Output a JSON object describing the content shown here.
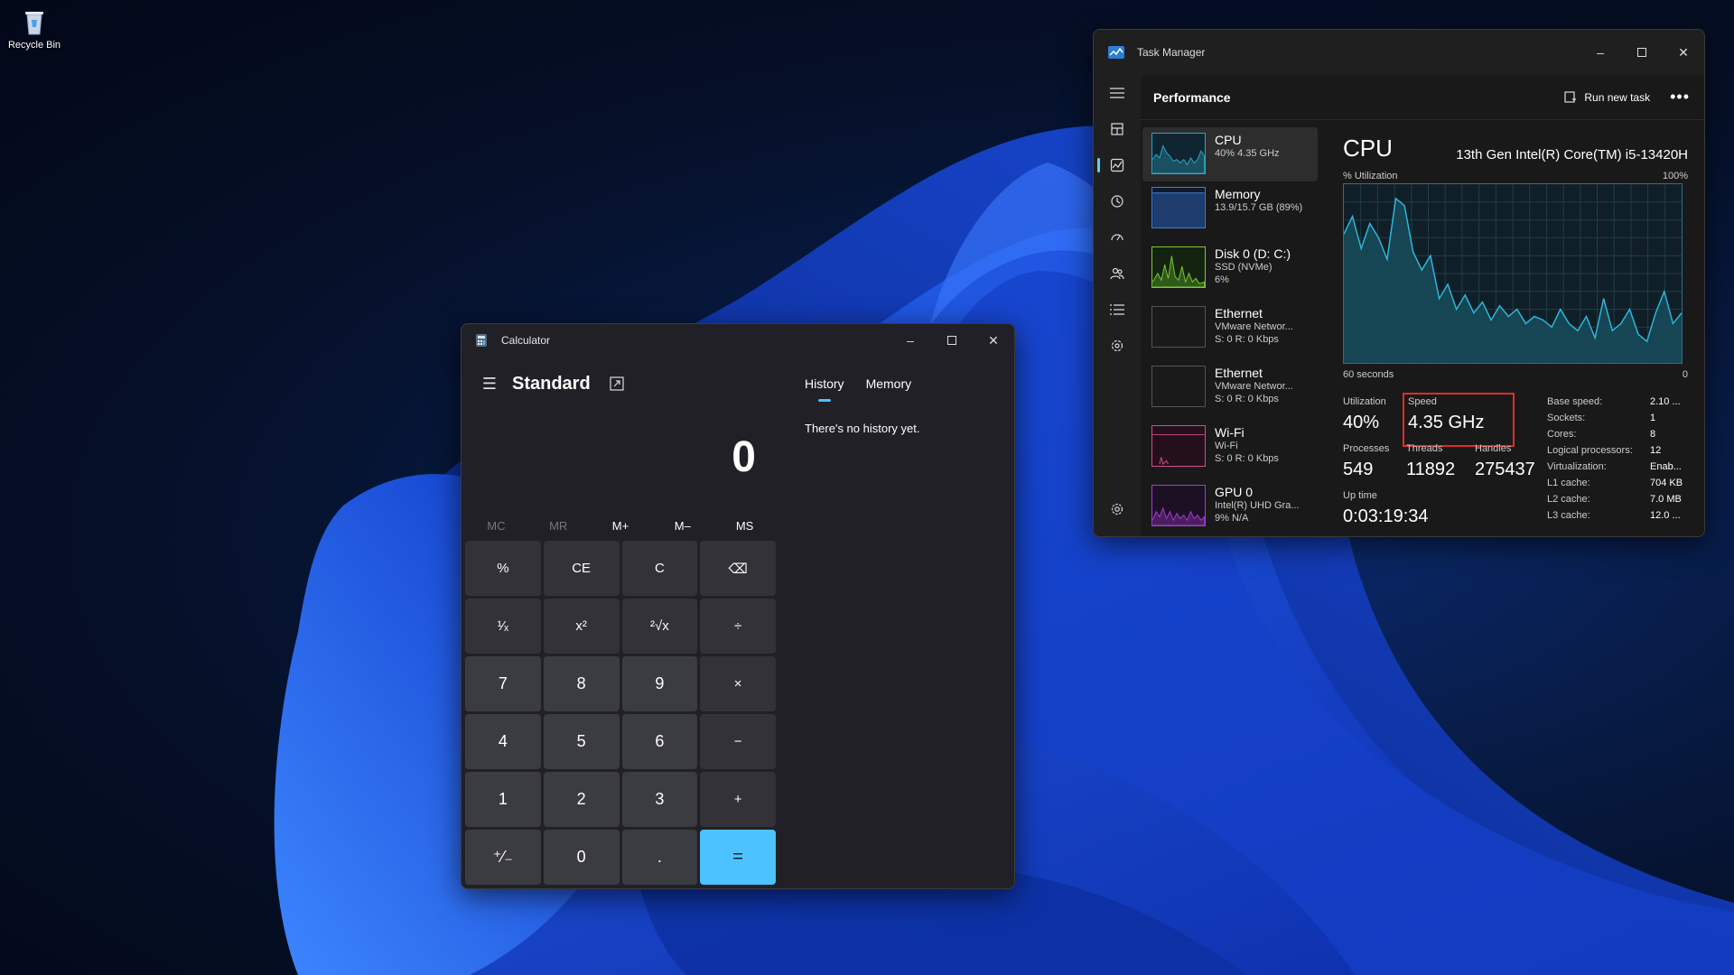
{
  "desktop": {
    "recycle_bin_label": "Recycle Bin"
  },
  "calculator": {
    "title": "Calculator",
    "mode": "Standard",
    "display": "0",
    "tabs": {
      "history": "History",
      "memory": "Memory"
    },
    "history_empty": "There's no history yet.",
    "memory_buttons": [
      "MC",
      "MR",
      "M+",
      "M–",
      "MS"
    ],
    "keys": {
      "percent": "%",
      "ce": "CE",
      "c": "C",
      "backspace": "⌫",
      "reciprocal": "¹⁄ₓ",
      "square": "x²",
      "sqrt": "²√x",
      "divide": "÷",
      "seven": "7",
      "eight": "8",
      "nine": "9",
      "multiply": "×",
      "four": "4",
      "five": "5",
      "six": "6",
      "minus": "−",
      "one": "1",
      "two": "2",
      "three": "3",
      "plus": "+",
      "negate": "⁺⁄₋",
      "zero": "0",
      "decimal": ".",
      "equals": "="
    },
    "accent": "#4cc2ff"
  },
  "task_manager": {
    "title": "Task Manager",
    "page_title": "Performance",
    "run_new_task": "Run new task",
    "more": "•••",
    "resources": [
      {
        "name": "CPU",
        "sub1": "40%  4.35 GHz",
        "sub2": "",
        "color": "#2aa8c9"
      },
      {
        "name": "Memory",
        "sub1": "13.9/15.7 GB (89%)",
        "sub2": "",
        "color": "#3f7fd6"
      },
      {
        "name": "Disk 0 (D: C:)",
        "sub1": "SSD (NVMe)",
        "sub2": "6%",
        "color": "#7dc63a"
      },
      {
        "name": "Ethernet",
        "sub1": "VMware Networ...",
        "sub2": "S: 0  R: 0 Kbps",
        "color": "#c9823f"
      },
      {
        "name": "Ethernet",
        "sub1": "VMware Networ...",
        "sub2": "S: 0  R: 0 Kbps",
        "color": "#c9823f"
      },
      {
        "name": "Wi-Fi",
        "sub1": "Wi-Fi",
        "sub2": "S: 0  R: 0 Kbps",
        "color": "#d04f8a"
      },
      {
        "name": "GPU 0",
        "sub1": "Intel(R) UHD Gra...",
        "sub2": "9%  N/A",
        "color": "#a43bd4"
      }
    ],
    "cpu": {
      "title": "CPU",
      "model": "13th Gen Intel(R) Core(TM) i5-13420H",
      "util_label": "% Utilization",
      "max_label": "100%",
      "time_label": "60 seconds",
      "zero_label": "0",
      "stats": {
        "utilization_label": "Utilization",
        "utilization": "40%",
        "speed_label": "Speed",
        "speed": "4.35 GHz",
        "processes_label": "Processes",
        "processes": "549",
        "threads_label": "Threads",
        "threads": "11892",
        "handles_label": "Handles",
        "handles": "275437",
        "uptime_label": "Up time",
        "uptime": "0:03:19:34"
      },
      "specs": [
        {
          "k": "Base speed:",
          "v": "2.10 ..."
        },
        {
          "k": "Sockets:",
          "v": "1"
        },
        {
          "k": "Cores:",
          "v": "8"
        },
        {
          "k": "Logical processors:",
          "v": "12"
        },
        {
          "k": "Virtualization:",
          "v": "Enab..."
        },
        {
          "k": "L1 cache:",
          "v": "704 KB"
        },
        {
          "k": "L2 cache:",
          "v": "7.0 MB"
        },
        {
          "k": "L3 cache:",
          "v": "12.0 ..."
        }
      ],
      "graph_values": [
        72,
        82,
        64,
        78,
        70,
        58,
        92,
        88,
        62,
        52,
        60,
        36,
        44,
        30,
        38,
        28,
        34,
        24,
        32,
        26,
        30,
        22,
        26,
        24,
        20,
        30,
        22,
        18,
        26,
        14,
        36,
        18,
        22,
        30,
        16,
        12,
        28,
        40,
        22,
        28
      ],
      "highlight_color": "#e02c2c"
    }
  }
}
